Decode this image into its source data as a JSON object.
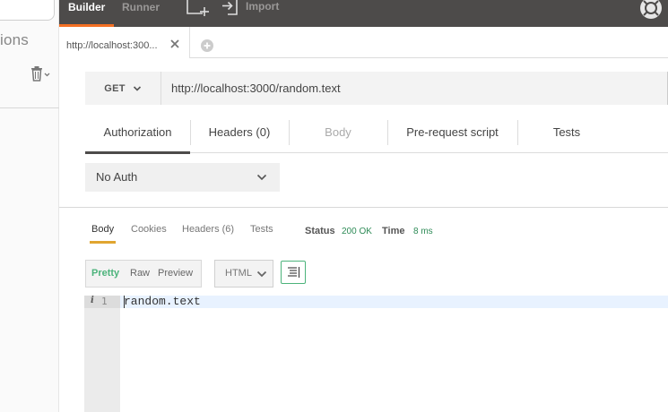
{
  "sidebar": {
    "title_fragment": "ions",
    "trash_icon": "trash-icon"
  },
  "topbar": {
    "builder_label": "Builder",
    "runner_label": "Runner",
    "import_label": "Import",
    "icons": [
      "new-window-icon",
      "import-icon",
      "sync-icon"
    ],
    "accent": "#f47023"
  },
  "request_tab": {
    "label": "http://localhost:300..."
  },
  "request": {
    "method": "GET",
    "url": "http://localhost:3000/random.text"
  },
  "request_subtabs": [
    {
      "label": "Authorization"
    },
    {
      "label": "Headers (0)"
    },
    {
      "label": "Body"
    },
    {
      "label": "Pre-request script"
    },
    {
      "label": "Tests"
    }
  ],
  "auth": {
    "selected": "No Auth"
  },
  "response": {
    "tabs": [
      {
        "label": "Body"
      },
      {
        "label": "Cookies"
      },
      {
        "label": "Headers (6)"
      },
      {
        "label": "Tests"
      }
    ],
    "status_label": "Status",
    "status_value": "200 OK",
    "time_label": "Time",
    "time_value": "8 ms",
    "view_modes": [
      {
        "label": "Pretty"
      },
      {
        "label": "Raw"
      },
      {
        "label": "Preview"
      }
    ],
    "language": "HTML",
    "line_number": "1",
    "gutter_marker": "i",
    "body_text": "random.text",
    "status_color": "#2e8b57"
  }
}
